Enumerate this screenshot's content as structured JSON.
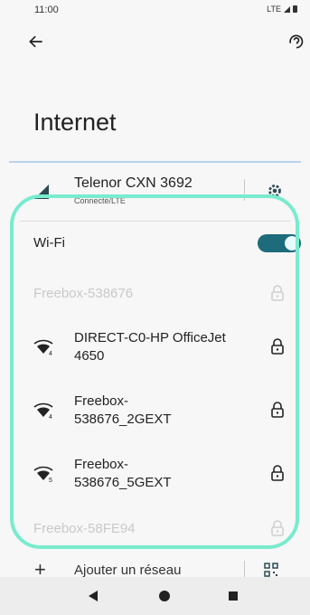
{
  "status_bar": {
    "time": "11:00",
    "network": "LTE"
  },
  "page": {
    "title": "Internet"
  },
  "mobile": {
    "name": "Telenor CXN 3692",
    "status": "Connecté/LTE"
  },
  "wifi": {
    "label": "Wi-Fi",
    "enabled": true
  },
  "networks": [
    {
      "name": "Freebox-538676",
      "locked": true
    },
    {
      "name": "DIRECT-C0-HP OfficeJet 4650",
      "locked": true,
      "badge": "4"
    },
    {
      "name": "Freebox-538676_2GEXT",
      "locked": true,
      "badge": "4"
    },
    {
      "name": "Freebox-538676_5GEXT",
      "locked": true,
      "badge": "5"
    },
    {
      "name": "Freebox-58FE94",
      "locked": true
    }
  ],
  "add_network": {
    "label": "Ajouter un réseau"
  },
  "accent_colors": {
    "toggle": "#1e6b7b",
    "highlight": "#79ebcf"
  }
}
